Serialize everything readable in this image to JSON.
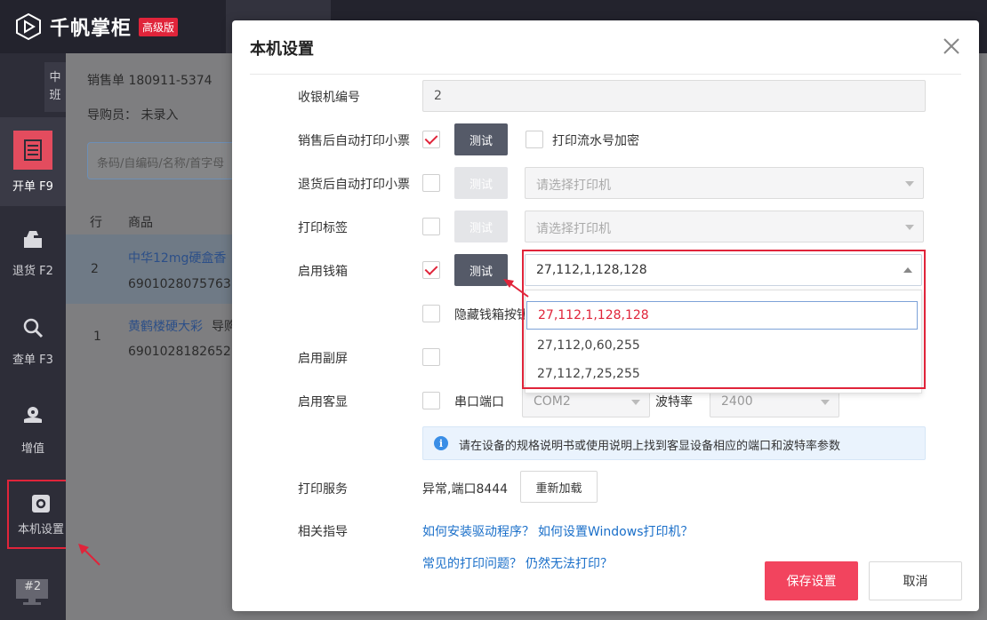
{
  "app": {
    "brand": "千帆掌柜",
    "edition_badge": "高级版",
    "shift": [
      "中",
      "班"
    ]
  },
  "sidebar": {
    "items": [
      {
        "label": "开单 F9",
        "icon": "receipt-icon"
      },
      {
        "label": "退货 F2",
        "icon": "return-box-icon"
      },
      {
        "label": "查单 F3",
        "icon": "search-icon"
      },
      {
        "label": "增值",
        "icon": "plant-icon"
      },
      {
        "label": "本机设置",
        "icon": "gear-icon"
      }
    ],
    "monitor_label": "#2"
  },
  "background": {
    "sale_no": "销售单 180911-5374",
    "salesperson": "导购员： 未录入",
    "search_placeholder": "条码/自编码/名称/首字母",
    "col_row": "行",
    "col_product": "商品",
    "rows": [
      {
        "no": "2",
        "name": "中华12mg硬盒香",
        "code": "6901028075763"
      },
      {
        "no": "1",
        "name": "黄鹤楼硬大彩",
        "extra": "导购",
        "code": "6901028182652"
      }
    ]
  },
  "modal": {
    "title": "本机设置",
    "register_no_label": "收银机编号",
    "register_no_value": "2",
    "auto_print_sale_label": "销售后自动打印小票",
    "test_label": "测试",
    "print_serial_encrypt_label": "打印流水号加密",
    "auto_print_return_label": "退货后自动打印小票",
    "printer_placeholder": "请选择打印机",
    "print_label_label": "打印标签",
    "cash_drawer_label": "启用钱箱",
    "cash_drawer_value": "27,112,1,128,128",
    "cash_drawer_options": [
      "27,112,1,128,128",
      "27,112,0,60,255",
      "27,112,7,25,255"
    ],
    "hide_drawer_button_label": "隐藏钱箱按钮",
    "secondary_screen_label": "启用副屏",
    "customer_display_label": "启用客显",
    "serial_port_label": "串口端口",
    "serial_port_value": "COM2",
    "baud_rate_label": "波特率",
    "baud_rate_value": "2400",
    "info_text": "请在设备的规格说明书或使用说明上找到客显设备相应的端口和波特率参数",
    "print_service_label": "打印服务",
    "print_service_status": "异常,端口8444",
    "reload_label": "重新加载",
    "guide_label": "相关指导",
    "link_driver": "如何安装驱动程序？",
    "link_windows_printer": "如何设置Windows打印机？",
    "link_common_issues": "常见的打印问题？",
    "link_still_cannot": "仍然无法打印？",
    "save_label": "保存设置",
    "cancel_label": "取消"
  },
  "colors": {
    "accent": "#e0243a",
    "save_button": "#f2445e",
    "link": "#1a6fc9",
    "sidebar_bg": "#2d2d38"
  }
}
